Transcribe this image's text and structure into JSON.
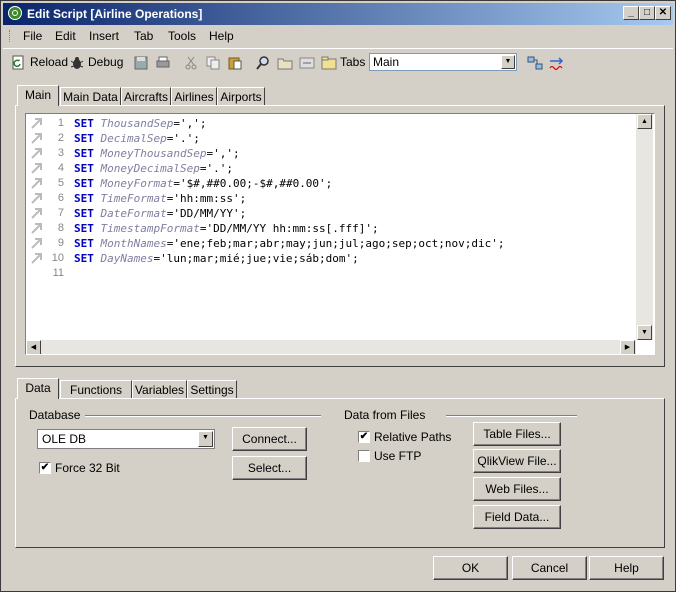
{
  "window": {
    "title": "Edit Script [Airline Operations]"
  },
  "menu": [
    "File",
    "Edit",
    "Insert",
    "Tab",
    "Tools",
    "Help"
  ],
  "toolbar": {
    "reload_label": "Reload",
    "debug_label": "Debug",
    "tabs_label": "Tabs",
    "tabs_selected": "Main"
  },
  "script_tabs": [
    "Main",
    "Main Data",
    "Aircrafts",
    "Airlines",
    "Airports"
  ],
  "script_lines": [
    {
      "num": "1",
      "kw": "SET",
      "var": "ThousandSep",
      "val": "=',';"
    },
    {
      "num": "2",
      "kw": "SET",
      "var": "DecimalSep",
      "val": "='.';"
    },
    {
      "num": "3",
      "kw": "SET",
      "var": "MoneyThousandSep",
      "val": "=',';"
    },
    {
      "num": "4",
      "kw": "SET",
      "var": "MoneyDecimalSep",
      "val": "='.';"
    },
    {
      "num": "5",
      "kw": "SET",
      "var": "MoneyFormat",
      "val": "='$#,##0.00;-$#,##0.00';"
    },
    {
      "num": "6",
      "kw": "SET",
      "var": "TimeFormat",
      "val": "='hh:mm:ss';"
    },
    {
      "num": "7",
      "kw": "SET",
      "var": "DateFormat",
      "val": "='DD/MM/YY';"
    },
    {
      "num": "8",
      "kw": "SET",
      "var": "TimestampFormat",
      "val": "='DD/MM/YY hh:mm:ss[.fff]';"
    },
    {
      "num": "9",
      "kw": "SET",
      "var": "MonthNames",
      "val": "='ene;feb;mar;abr;may;jun;jul;ago;sep;oct;nov;dic';"
    },
    {
      "num": "10",
      "kw": "SET",
      "var": "DayNames",
      "val": "='lun;mar;mié;jue;vie;sáb;dom';"
    },
    {
      "num": "11",
      "kw": "",
      "var": "",
      "val": ""
    }
  ],
  "bottom_tabs": [
    "Data",
    "Functions",
    "Variables",
    "Settings"
  ],
  "database": {
    "group_label": "Database",
    "selected": "OLE DB",
    "force32_label": "Force 32 Bit",
    "force32_checked": true,
    "connect_label": "Connect...",
    "select_label": "Select..."
  },
  "files": {
    "group_label": "Data from Files",
    "relative_paths_label": "Relative Paths",
    "relative_paths_checked": true,
    "use_ftp_label": "Use FTP",
    "use_ftp_checked": false,
    "table_files_label": "Table Files...",
    "qlikview_file_label": "QlikView File...",
    "web_files_label": "Web Files...",
    "field_data_label": "Field Data..."
  },
  "dialog": {
    "ok_label": "OK",
    "cancel_label": "Cancel",
    "help_label": "Help"
  }
}
